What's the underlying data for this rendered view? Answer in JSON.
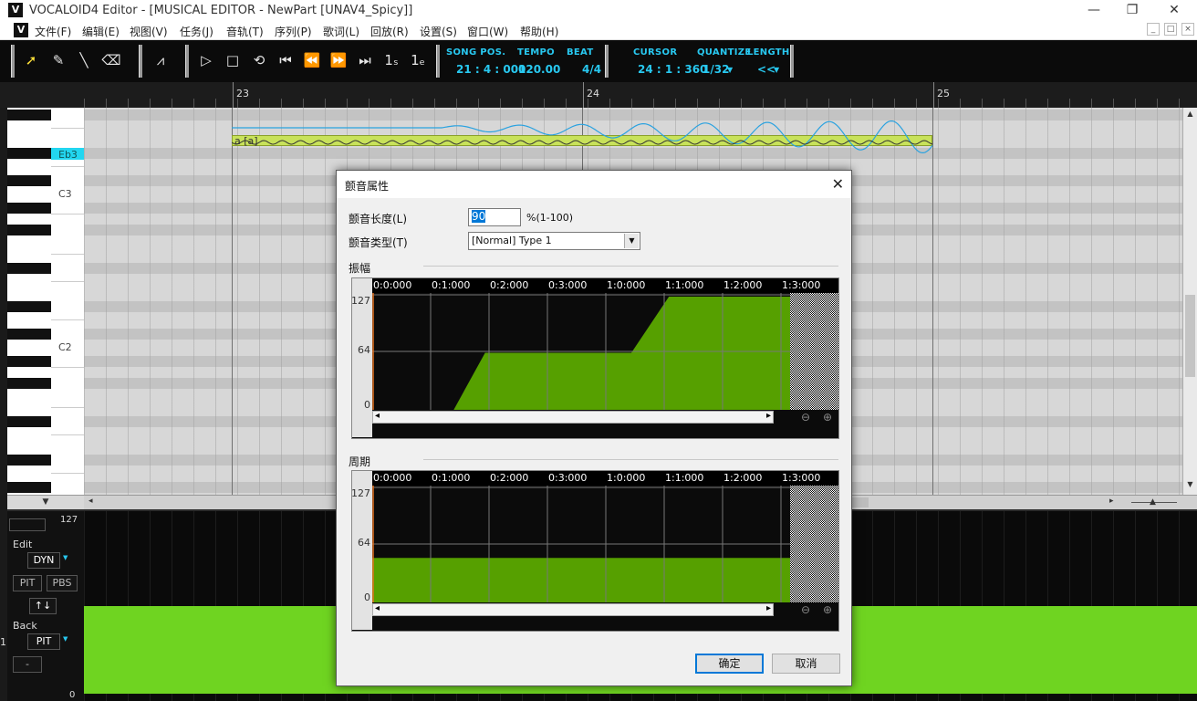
{
  "window": {
    "title": "VOCALOID4 Editor - [MUSICAL EDITOR - NewPart [UNAV4_Spicy]]",
    "logo": "V",
    "controls": [
      "minimize-icon",
      "restore-icon",
      "close-icon"
    ]
  },
  "menu": {
    "items": [
      "文件(F)",
      "编辑(E)",
      "视图(V)",
      "任务(J)",
      "音轨(T)",
      "序列(P)",
      "歌词(L)",
      "回放(R)",
      "设置(S)",
      "窗口(W)",
      "帮助(H)"
    ],
    "mdi_controls": [
      "_",
      "□",
      "×"
    ]
  },
  "toolbar": {
    "song_pos_label": "SONG POS.",
    "song_pos": "21 : 4 : 000",
    "tempo_label": "TEMPO",
    "tempo": "120.00",
    "beat_label": "BEAT",
    "beat": "4/4",
    "cursor_label": "CURSOR",
    "cursor": "24 : 1 : 360",
    "quantize_label": "QUANTIZE",
    "quantize": "1/32",
    "length_label": "LENGTH",
    "length": "<<"
  },
  "ruler": {
    "bars": [
      "23",
      "24",
      "25"
    ]
  },
  "piano": {
    "highlight": "Eb3",
    "labels": [
      "C3",
      "C2"
    ]
  },
  "note": {
    "lyric": "a [a]"
  },
  "control_panel": {
    "top_value": "127",
    "bottom_value": "0",
    "edit_label": "Edit",
    "edit_select": "DYN",
    "pit_label": "PIT",
    "pbs_label": "PBS",
    "arrows_label": "↑↓",
    "back_label": "Back",
    "back_select": "PIT",
    "dash_label": "-",
    "side_value": "1"
  },
  "dialog": {
    "title": "颤音属性",
    "length_label": "颤音长度(L)",
    "length_value": "90",
    "length_range": "%(1-100)",
    "type_label": "颤音类型(T)",
    "type_value": "[Normal] Type 1",
    "amplitude_section": "振幅",
    "period_section": "周期",
    "time_ticks": [
      "0:0:000",
      "0:1:000",
      "0:2:000",
      "0:3:000",
      "1:0:000",
      "1:1:000",
      "1:2:000",
      "1:3:000"
    ],
    "y_ticks": [
      "127",
      "64",
      "0"
    ],
    "amplitude_envelope": [
      {
        "t": 0.0,
        "v": 0
      },
      {
        "t": 0.195,
        "v": 0
      },
      {
        "t": 0.27,
        "v": 64
      },
      {
        "t": 0.62,
        "v": 64
      },
      {
        "t": 0.71,
        "v": 127
      },
      {
        "t": 1.0,
        "v": 127
      }
    ],
    "period_envelope": [
      {
        "t": 0.0,
        "v": 50
      },
      {
        "t": 1.0,
        "v": 50
      }
    ],
    "ok_label": "确定",
    "cancel_label": "取消"
  },
  "colors": {
    "accent_cyan": "#28c8f0",
    "envelope_green": "#56a000",
    "control_green": "#6fd421",
    "note_fill": "#c8e25a"
  }
}
